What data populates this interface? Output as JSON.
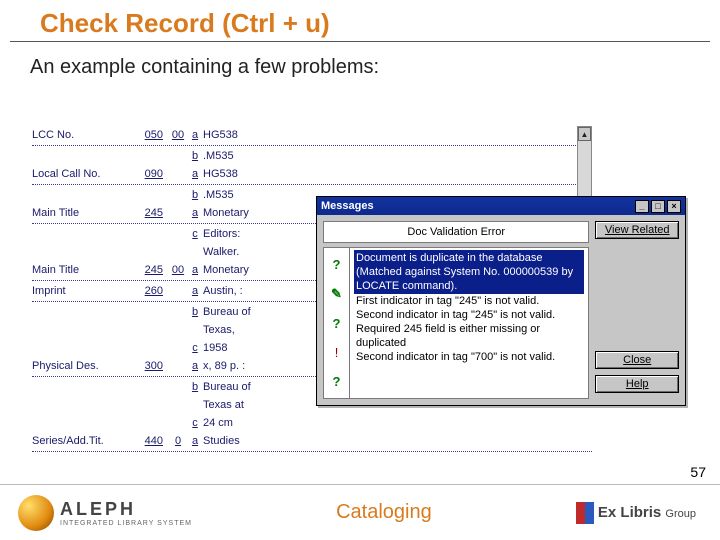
{
  "slide": {
    "title": "Check Record (Ctrl + u)",
    "subtitle": "An example containing a few problems:",
    "page_number": "57"
  },
  "editor": {
    "rows": [
      {
        "label": "LCC No.",
        "tag": "050",
        "ind1": "00",
        "sf": "a",
        "text": "HG538"
      },
      {
        "label": "",
        "tag": "",
        "ind1": "",
        "sf": "b",
        "text": ".M535"
      },
      {
        "label": "Local Call No.",
        "tag": "090",
        "ind1": "",
        "sf": "a",
        "text": "HG538"
      },
      {
        "label": "",
        "tag": "",
        "ind1": "",
        "sf": "b",
        "text": ".M535"
      },
      {
        "label": "Main Title",
        "tag": "245",
        "ind1": "",
        "sf": "a",
        "text": "Monetary"
      },
      {
        "label": "",
        "tag": "",
        "ind1": "",
        "sf": "c",
        "text": "Editors:"
      },
      {
        "label": "",
        "tag": "",
        "ind1": "",
        "sf": "",
        "text": "Walker."
      },
      {
        "label": "Main Title",
        "tag": "245",
        "ind1": "00",
        "sf": "a",
        "text": "Monetary"
      },
      {
        "label": "Imprint",
        "tag": "260",
        "ind1": "",
        "sf": "a",
        "text": "Austin, :"
      },
      {
        "label": "",
        "tag": "",
        "ind1": "",
        "sf": "b",
        "text": "Bureau of"
      },
      {
        "label": "",
        "tag": "",
        "ind1": "",
        "sf": "",
        "text": "Texas,"
      },
      {
        "label": "",
        "tag": "",
        "ind1": "",
        "sf": "c",
        "text": "1958"
      },
      {
        "label": "Physical Des.",
        "tag": "300",
        "ind1": "",
        "sf": "a",
        "text": "x, 89 p. :"
      },
      {
        "label": "",
        "tag": "",
        "ind1": "",
        "sf": "b",
        "text": "Bureau of"
      },
      {
        "label": "",
        "tag": "",
        "ind1": "",
        "sf": "",
        "text": "Texas at"
      },
      {
        "label": "",
        "tag": "",
        "ind1": "",
        "sf": "c",
        "text": "24 cm"
      },
      {
        "label": "Series/Add.Tit.",
        "tag": "440",
        "ind1": "0",
        "sf": "a",
        "text": "Studies"
      }
    ]
  },
  "dialog": {
    "title": "Messages",
    "header": "Doc Validation Error",
    "btn_view": "View Related",
    "btn_close": "Close",
    "btn_help": "Help",
    "messages": [
      {
        "icon": "question",
        "selected": true,
        "text": "Document is duplicate in the database (Matched against System No. 000000539 by LOCATE command)."
      },
      {
        "icon": "edit",
        "text": "First indicator in tag \"245\" is not valid."
      },
      {
        "icon": "question",
        "text": "Second indicator in tag \"245\" is not valid."
      },
      {
        "icon": "bang",
        "text": "Required 245 field is either missing or duplicated"
      },
      {
        "icon": "question",
        "text": "Second indicator in tag \"700\" is not valid."
      }
    ]
  },
  "footer": {
    "brand_name": "ALEPH",
    "brand_sub": "INTEGRATED LIBRARY SYSTEM",
    "center": "Cataloging",
    "right": "Ex Libris",
    "right_suffix": "Group"
  }
}
